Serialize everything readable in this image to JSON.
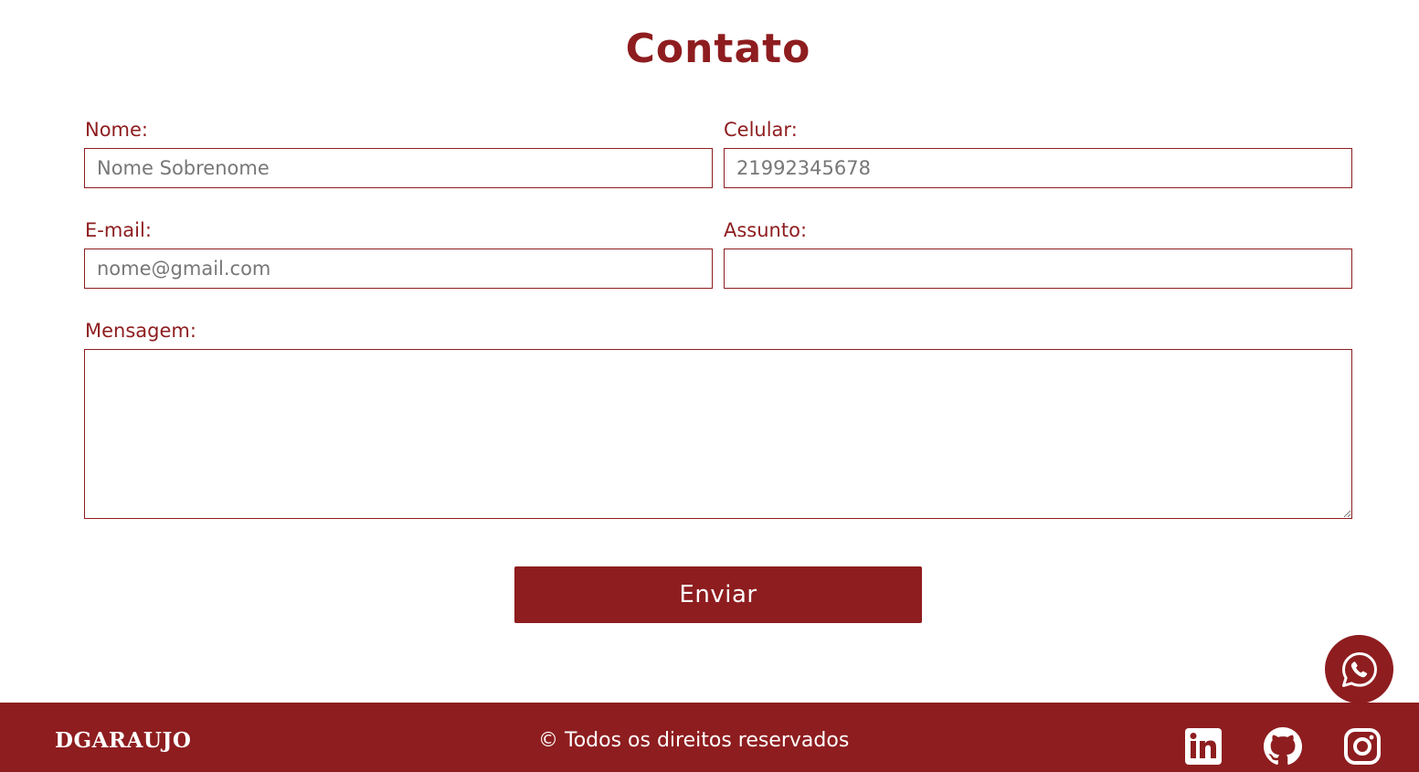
{
  "page": {
    "title": "Contato"
  },
  "form": {
    "nome": {
      "label": "Nome:",
      "placeholder": "Nome Sobrenome",
      "value": ""
    },
    "celular": {
      "label": "Celular:",
      "placeholder": "21992345678",
      "value": ""
    },
    "email": {
      "label": "E-mail:",
      "placeholder": "nome@gmail.com",
      "value": ""
    },
    "assunto": {
      "label": "Assunto:",
      "placeholder": "",
      "value": ""
    },
    "mensagem": {
      "label": "Mensagem:",
      "placeholder": "",
      "value": ""
    },
    "submit_label": "Enviar"
  },
  "floating": {
    "icon": "whatsapp-icon"
  },
  "footer": {
    "brand": "DGARAUJO",
    "copyright": "© Todos os direitos reservados",
    "social": [
      {
        "icon": "linkedin-icon"
      },
      {
        "icon": "github-icon"
      },
      {
        "icon": "instagram-icon"
      }
    ]
  },
  "colors": {
    "accent": "#8e1d1f",
    "background": "#ffffff",
    "footer_text": "#ffffff"
  }
}
